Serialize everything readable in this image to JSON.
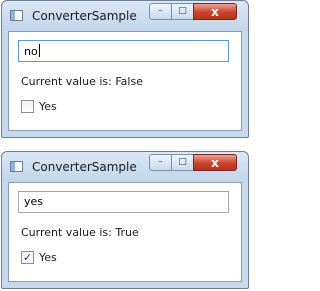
{
  "windows": [
    {
      "title": "ConverterSample",
      "controls": {
        "minimize": "–",
        "maximize": "□",
        "close": "x"
      },
      "input_value": "no",
      "status_text": "Current value is: False",
      "checkbox": {
        "label": "Yes",
        "checked": false,
        "mark": ""
      }
    },
    {
      "title": "ConverterSample",
      "controls": {
        "minimize": "–",
        "maximize": "□",
        "close": "x"
      },
      "input_value": "yes",
      "status_text": "Current value is: True",
      "checkbox": {
        "label": "Yes",
        "checked": true,
        "mark": "✓"
      }
    }
  ]
}
